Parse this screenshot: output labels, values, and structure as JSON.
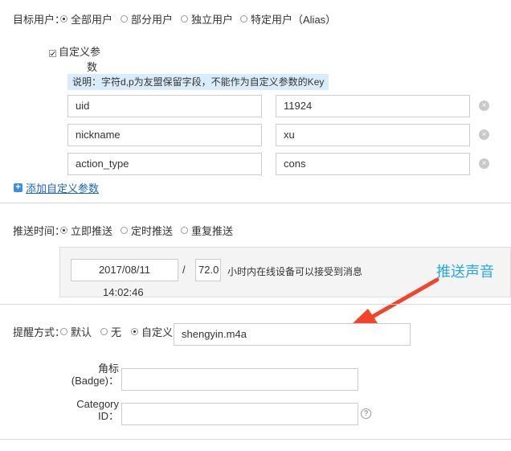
{
  "target": {
    "label": "目标用户：",
    "options": [
      {
        "label": "全部用户",
        "checked": true
      },
      {
        "label": "部分用户",
        "checked": false
      },
      {
        "label": "独立用户",
        "checked": false
      },
      {
        "label": "特定用户（Alias）",
        "checked": false
      }
    ]
  },
  "custom_params": {
    "checkbox_label_line1": "自定义参",
    "checkbox_label_line2": "数",
    "checked": true,
    "note": "说明：字符d,p为友盟保留字段，不能作为自定义参数的Key",
    "rows": [
      {
        "key": "uid",
        "value": "11924"
      },
      {
        "key": "nickname",
        "value": "xu"
      },
      {
        "key": "action_type",
        "value": "cons"
      }
    ],
    "clear_glyph": "×",
    "add_icon": "plus-icon",
    "add_glyph": "+",
    "add_label": "添加自定义参数"
  },
  "send_time": {
    "label": "推送时间：",
    "options": [
      {
        "label": "立即推送",
        "checked": true
      },
      {
        "label": "定时推送",
        "checked": false
      },
      {
        "label": "重复推送",
        "checked": false
      }
    ],
    "date": "2017/08/11",
    "time": "14:02:46",
    "separator": "/",
    "hours": "72.0",
    "hours_suffix": "小时内在线设备可以接受到消息"
  },
  "annotation": {
    "text": "推送声音",
    "color": "#29a8e0",
    "arrow_color": "#f0452a"
  },
  "reminder": {
    "label": "提醒方式：",
    "options": [
      {
        "label": "默认",
        "checked": false
      },
      {
        "label": "无",
        "checked": false
      },
      {
        "label": "自定义",
        "checked": true
      }
    ],
    "sound_value": "shengyin.m4a"
  },
  "badge": {
    "label_line1": "角标",
    "label_line2": "(Badge)：",
    "value": ""
  },
  "category": {
    "label_line1": "Category",
    "label_line2": "ID：",
    "value": "",
    "help_glyph": "?"
  }
}
